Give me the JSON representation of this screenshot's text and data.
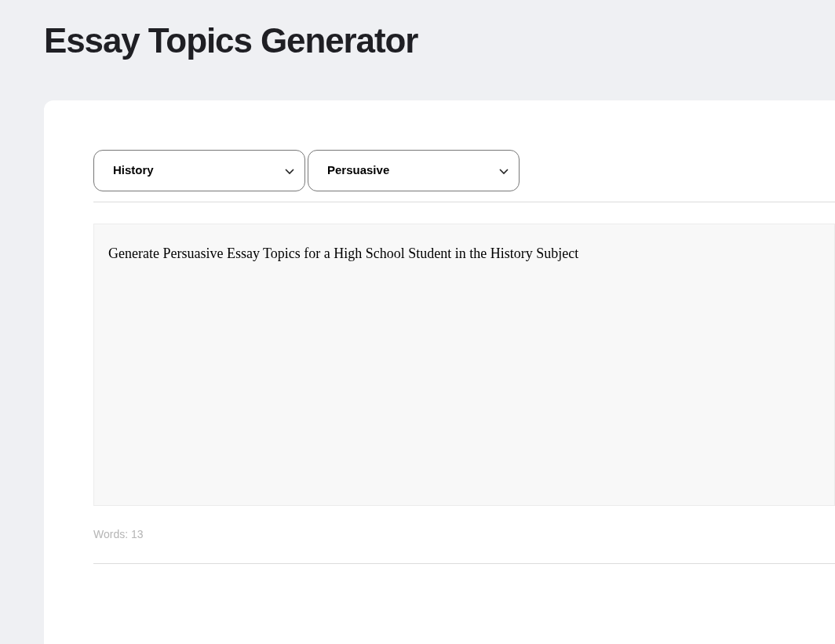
{
  "title": "Essay Topics Generator",
  "selects": [
    {
      "value": "History"
    },
    {
      "value": "Persuasive"
    }
  ],
  "prompt": {
    "value": "Generate Persuasive Essay Topics for a High School Student in the History Subject"
  },
  "word_count": "Words: 13"
}
